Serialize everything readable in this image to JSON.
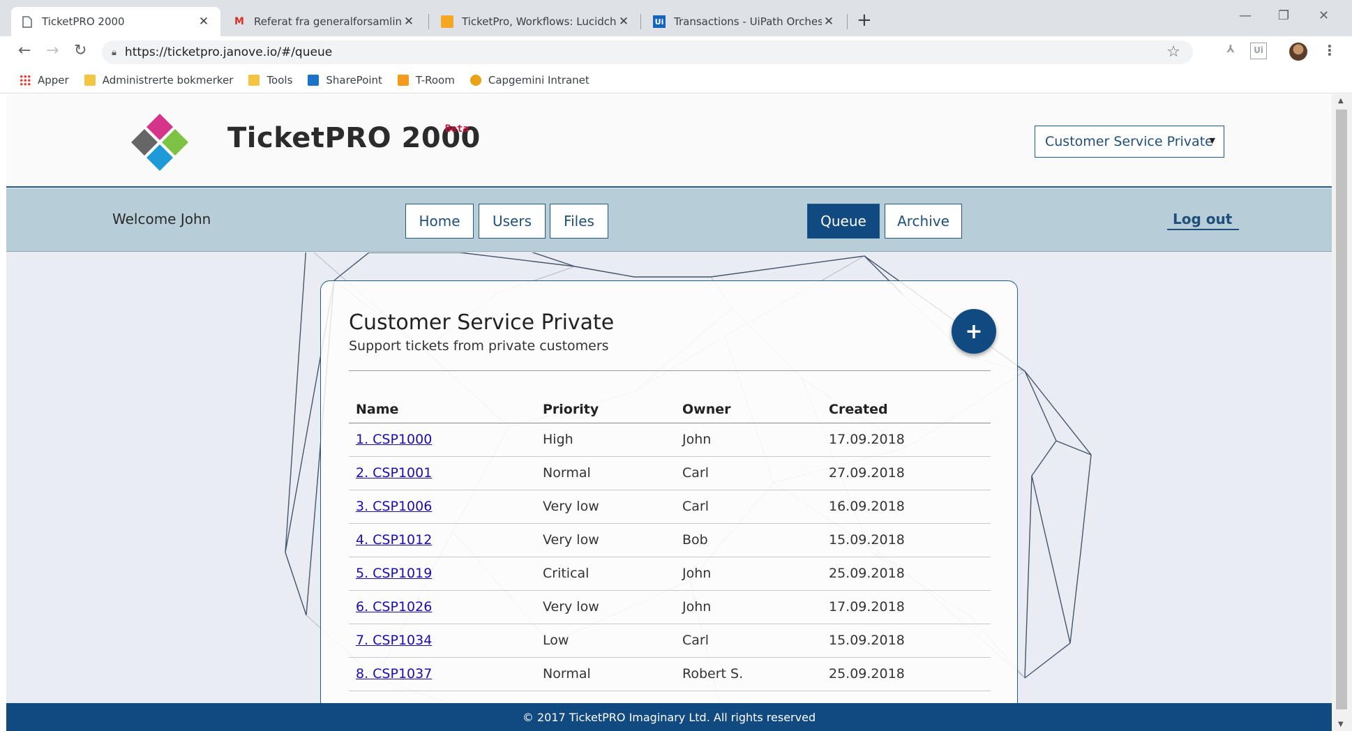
{
  "browser": {
    "tabs": [
      {
        "label": "TicketPRO 2000",
        "icon": "page-icon"
      },
      {
        "label": "Referat fra generalforsamling + e",
        "icon": "gmail-icon"
      },
      {
        "label": "TicketPro, Workflows: Lucidchart",
        "icon": "lucidchart-icon"
      },
      {
        "label": "Transactions - UiPath Orchestrato",
        "icon": "uipath-icon"
      }
    ],
    "url": "https://ticketpro.janove.io/#/queue",
    "bookmarks": [
      {
        "label": "Apper",
        "icon": "apps-grid-icon"
      },
      {
        "label": "Administrerte bokmerker",
        "icon": "folder-icon"
      },
      {
        "label": "Tools",
        "icon": "folder-icon"
      },
      {
        "label": "SharePoint",
        "icon": "sharepoint-icon"
      },
      {
        "label": "T-Room",
        "icon": "troom-icon"
      },
      {
        "label": "Capgemini Intranet",
        "icon": "capgemini-icon"
      }
    ]
  },
  "header": {
    "title": "TicketPRO 2000",
    "badge": "Beta",
    "queue_select": "Customer Service Private"
  },
  "nav": {
    "welcome": "Welcome John",
    "buttons": [
      "Home",
      "Users",
      "Files"
    ],
    "queue": "Queue",
    "archive": "Archive",
    "logout": "Log out"
  },
  "queue": {
    "title": "Customer Service Private",
    "subtitle": "Support tickets from private customers",
    "add_label": "+",
    "columns": [
      "Name",
      "Priority",
      "Owner",
      "Created"
    ],
    "rows": [
      {
        "name": "1. CSP1000",
        "priority": "High",
        "owner": "John",
        "created": "17.09.2018"
      },
      {
        "name": "2. CSP1001",
        "priority": "Normal",
        "owner": "Carl",
        "created": "27.09.2018"
      },
      {
        "name": "3. CSP1006",
        "priority": "Very low",
        "owner": "Carl",
        "created": "16.09.2018"
      },
      {
        "name": "4. CSP1012",
        "priority": "Very low",
        "owner": "Bob",
        "created": "15.09.2018"
      },
      {
        "name": "5. CSP1019",
        "priority": "Critical",
        "owner": "John",
        "created": "25.09.2018"
      },
      {
        "name": "6. CSP1026",
        "priority": "Very low",
        "owner": "John",
        "created": "17.09.2018"
      },
      {
        "name": "7. CSP1034",
        "priority": "Low",
        "owner": "Carl",
        "created": "15.09.2018"
      },
      {
        "name": "8. CSP1037",
        "priority": "Normal",
        "owner": "Robert S.",
        "created": "25.09.2018"
      }
    ]
  },
  "footer": {
    "text": "© 2017 TicketPRO Imaginary Ltd. All rights reserved"
  },
  "colors": {
    "primary": "#104a80",
    "navbar": "#b7cdd7",
    "beta": "#d0103a"
  }
}
